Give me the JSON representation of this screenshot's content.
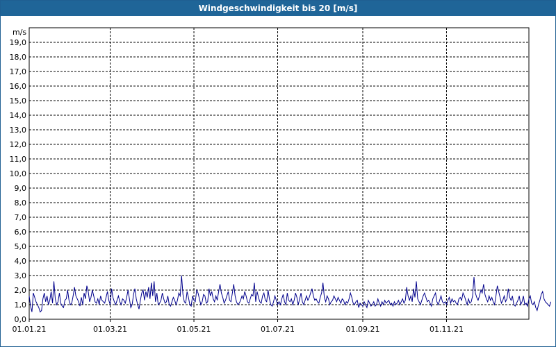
{
  "chart_data": {
    "type": "line",
    "title": "Windgeschwindigkeit bis 20 [m/s]",
    "ylabel": "m/s",
    "ylim": [
      0,
      20
    ],
    "yticks": [
      "0,0",
      "1,0",
      "2,0",
      "3,0",
      "4,0",
      "5,0",
      "6,0",
      "7,0",
      "8,0",
      "9,0",
      "10,0",
      "11,0",
      "12,0",
      "13,0",
      "14,0",
      "15,0",
      "16,0",
      "17,0",
      "18,0",
      "19,0"
    ],
    "xticks": [
      "01.01.21",
      "01.03.21",
      "01.05.21",
      "01.07.21",
      "01.09.21",
      "01.11.21"
    ],
    "xlim": [
      "01.01.21",
      "31.12.21"
    ],
    "grid": true,
    "line_color": "#00008b",
    "series": [
      {
        "x_start": "01.01.21",
        "x_step_days": 1,
        "values": [
          1.6,
          0.9,
          0.5,
          1.8,
          1.5,
          1.2,
          1.0,
          0.8,
          0.5,
          0.6,
          1.4,
          1.8,
          1.2,
          1.6,
          1.0,
          1.3,
          1.9,
          1.1,
          2.6,
          1.4,
          1.0,
          1.2,
          1.8,
          1.1,
          0.9,
          0.8,
          1.3,
          1.4,
          2.0,
          1.3,
          1.0,
          1.1,
          1.6,
          2.2,
          1.6,
          1.4,
          1.2,
          0.9,
          1.5,
          1.0,
          1.8,
          1.4,
          2.3,
          1.9,
          1.2,
          1.5,
          2.0,
          1.6,
          1.2,
          1.1,
          1.4,
          1.0,
          1.6,
          1.3,
          1.2,
          1.1,
          1.5,
          1.9,
          1.3,
          1.0,
          2.1,
          1.5,
          1.2,
          1.0,
          1.3,
          1.6,
          1.2,
          1.0,
          1.4,
          1.3,
          1.1,
          1.5,
          2.0,
          1.4,
          0.8,
          1.0,
          1.7,
          2.1,
          1.4,
          1.0,
          0.7,
          1.3,
          1.8,
          2.0,
          1.3,
          1.9,
          1.5,
          2.2,
          1.4,
          2.5,
          1.6,
          2.6,
          1.2,
          1.8,
          1.0,
          1.1,
          1.3,
          1.8,
          1.4,
          1.1,
          1.2,
          1.6,
          1.0,
          0.9,
          1.2,
          1.5,
          1.3,
          1.0,
          1.3,
          1.8,
          1.6,
          3.0,
          1.7,
          1.2,
          1.1,
          1.9,
          1.5,
          1.0,
          0.9,
          1.6,
          1.3,
          1.2,
          2.0,
          1.8,
          1.4,
          1.0,
          1.2,
          1.7,
          1.6,
          1.1,
          1.2,
          2.1,
          1.6,
          1.9,
          1.4,
          1.2,
          1.6,
          1.3,
          1.9,
          2.4,
          1.8,
          1.5,
          1.1,
          1.3,
          1.6,
          1.9,
          1.3,
          1.2,
          1.8,
          2.4,
          1.6,
          1.2,
          1.0,
          1.1,
          1.3,
          1.6,
          1.4,
          1.9,
          1.6,
          1.2,
          1.1,
          1.4,
          1.7,
          1.6,
          2.5,
          1.2,
          1.9,
          1.5,
          1.2,
          1.1,
          1.6,
          1.8,
          1.3,
          1.2,
          2.0,
          1.4,
          1.0,
          0.9,
          1.2,
          1.6,
          1.3,
          1.0,
          1.2,
          1.0,
          1.4,
          1.7,
          1.2,
          1.0,
          1.8,
          1.3,
          1.2,
          1.4,
          1.0,
          1.3,
          1.8,
          1.5,
          1.0,
          1.4,
          1.8,
          1.2,
          1.0,
          1.3,
          1.6,
          1.3,
          1.5,
          1.8,
          2.1,
          1.6,
          1.3,
          1.4,
          1.2,
          1.1,
          1.5,
          1.8,
          2.5,
          1.5,
          1.2,
          1.6,
          1.4,
          1.0,
          1.2,
          1.3,
          1.6,
          1.4,
          1.2,
          1.5,
          1.3,
          1.1,
          1.4,
          1.3,
          1.0,
          1.2,
          1.1,
          1.4,
          1.8,
          1.5,
          1.1,
          1.0,
          1.2,
          1.3,
          0.8,
          1.1,
          1.0,
          0.9,
          1.2,
          1.0,
          0.8,
          1.3,
          1.1,
          0.9,
          1.0,
          1.2,
          0.9,
          1.0,
          1.4,
          1.1,
          0.9,
          1.2,
          1.0,
          1.3,
          1.1,
          1.2,
          1.3,
          1.0,
          1.1,
          0.9,
          1.2,
          1.0,
          1.1,
          1.3,
          1.0,
          1.2,
          1.4,
          1.1,
          1.3,
          2.2,
          1.6,
          1.3,
          1.6,
          1.2,
          2.1,
          1.5,
          2.6,
          1.4,
          1.2,
          1.0,
          1.3,
          1.6,
          1.8,
          1.5,
          1.2,
          1.3,
          1.1,
          0.9,
          1.4,
          1.6,
          1.8,
          1.2,
          1.0,
          1.3,
          1.6,
          1.2,
          1.1,
          1.2,
          1.0,
          1.3,
          1.5,
          1.1,
          1.4,
          1.2,
          1.3,
          1.1,
          1.0,
          1.4,
          1.5,
          1.3,
          1.8,
          1.6,
          1.3,
          1.0,
          1.4,
          1.1,
          1.2,
          1.6,
          2.9,
          1.8,
          1.5,
          1.3,
          1.6,
          2.0,
          1.8,
          2.4,
          1.7,
          1.4,
          1.2,
          1.6,
          1.3,
          1.5,
          1.2,
          1.0,
          1.6,
          2.3,
          1.9,
          1.5,
          1.1,
          1.3,
          1.6,
          1.2,
          1.4,
          2.1,
          1.5,
          1.3,
          1.6,
          1.0,
          0.9,
          1.1,
          1.3,
          1.6,
          1.0,
          1.2,
          1.6,
          1.0,
          1.1,
          0.9,
          1.4,
          1.6,
          1.1,
          1.0,
          1.2,
          0.8,
          0.6,
          1.0,
          1.3,
          1.7,
          1.9,
          1.4,
          1.2,
          1.1,
          1.0,
          0.9,
          1.2
        ]
      }
    ]
  }
}
